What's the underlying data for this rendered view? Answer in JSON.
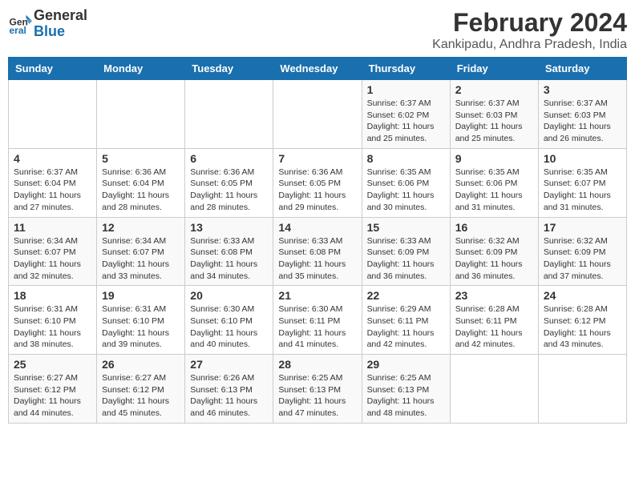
{
  "header": {
    "logo_general": "General",
    "logo_blue": "Blue",
    "title": "February 2024",
    "location": "Kankipadu, Andhra Pradesh, India"
  },
  "days_of_week": [
    "Sunday",
    "Monday",
    "Tuesday",
    "Wednesday",
    "Thursday",
    "Friday",
    "Saturday"
  ],
  "weeks": [
    [
      {
        "day": "",
        "info": ""
      },
      {
        "day": "",
        "info": ""
      },
      {
        "day": "",
        "info": ""
      },
      {
        "day": "",
        "info": ""
      },
      {
        "day": "1",
        "info": "Sunrise: 6:37 AM\nSunset: 6:02 PM\nDaylight: 11 hours\nand 25 minutes."
      },
      {
        "day": "2",
        "info": "Sunrise: 6:37 AM\nSunset: 6:03 PM\nDaylight: 11 hours\nand 25 minutes."
      },
      {
        "day": "3",
        "info": "Sunrise: 6:37 AM\nSunset: 6:03 PM\nDaylight: 11 hours\nand 26 minutes."
      }
    ],
    [
      {
        "day": "4",
        "info": "Sunrise: 6:37 AM\nSunset: 6:04 PM\nDaylight: 11 hours\nand 27 minutes."
      },
      {
        "day": "5",
        "info": "Sunrise: 6:36 AM\nSunset: 6:04 PM\nDaylight: 11 hours\nand 28 minutes."
      },
      {
        "day": "6",
        "info": "Sunrise: 6:36 AM\nSunset: 6:05 PM\nDaylight: 11 hours\nand 28 minutes."
      },
      {
        "day": "7",
        "info": "Sunrise: 6:36 AM\nSunset: 6:05 PM\nDaylight: 11 hours\nand 29 minutes."
      },
      {
        "day": "8",
        "info": "Sunrise: 6:35 AM\nSunset: 6:06 PM\nDaylight: 11 hours\nand 30 minutes."
      },
      {
        "day": "9",
        "info": "Sunrise: 6:35 AM\nSunset: 6:06 PM\nDaylight: 11 hours\nand 31 minutes."
      },
      {
        "day": "10",
        "info": "Sunrise: 6:35 AM\nSunset: 6:07 PM\nDaylight: 11 hours\nand 31 minutes."
      }
    ],
    [
      {
        "day": "11",
        "info": "Sunrise: 6:34 AM\nSunset: 6:07 PM\nDaylight: 11 hours\nand 32 minutes."
      },
      {
        "day": "12",
        "info": "Sunrise: 6:34 AM\nSunset: 6:07 PM\nDaylight: 11 hours\nand 33 minutes."
      },
      {
        "day": "13",
        "info": "Sunrise: 6:33 AM\nSunset: 6:08 PM\nDaylight: 11 hours\nand 34 minutes."
      },
      {
        "day": "14",
        "info": "Sunrise: 6:33 AM\nSunset: 6:08 PM\nDaylight: 11 hours\nand 35 minutes."
      },
      {
        "day": "15",
        "info": "Sunrise: 6:33 AM\nSunset: 6:09 PM\nDaylight: 11 hours\nand 36 minutes."
      },
      {
        "day": "16",
        "info": "Sunrise: 6:32 AM\nSunset: 6:09 PM\nDaylight: 11 hours\nand 36 minutes."
      },
      {
        "day": "17",
        "info": "Sunrise: 6:32 AM\nSunset: 6:09 PM\nDaylight: 11 hours\nand 37 minutes."
      }
    ],
    [
      {
        "day": "18",
        "info": "Sunrise: 6:31 AM\nSunset: 6:10 PM\nDaylight: 11 hours\nand 38 minutes."
      },
      {
        "day": "19",
        "info": "Sunrise: 6:31 AM\nSunset: 6:10 PM\nDaylight: 11 hours\nand 39 minutes."
      },
      {
        "day": "20",
        "info": "Sunrise: 6:30 AM\nSunset: 6:10 PM\nDaylight: 11 hours\nand 40 minutes."
      },
      {
        "day": "21",
        "info": "Sunrise: 6:30 AM\nSunset: 6:11 PM\nDaylight: 11 hours\nand 41 minutes."
      },
      {
        "day": "22",
        "info": "Sunrise: 6:29 AM\nSunset: 6:11 PM\nDaylight: 11 hours\nand 42 minutes."
      },
      {
        "day": "23",
        "info": "Sunrise: 6:28 AM\nSunset: 6:11 PM\nDaylight: 11 hours\nand 42 minutes."
      },
      {
        "day": "24",
        "info": "Sunrise: 6:28 AM\nSunset: 6:12 PM\nDaylight: 11 hours\nand 43 minutes."
      }
    ],
    [
      {
        "day": "25",
        "info": "Sunrise: 6:27 AM\nSunset: 6:12 PM\nDaylight: 11 hours\nand 44 minutes."
      },
      {
        "day": "26",
        "info": "Sunrise: 6:27 AM\nSunset: 6:12 PM\nDaylight: 11 hours\nand 45 minutes."
      },
      {
        "day": "27",
        "info": "Sunrise: 6:26 AM\nSunset: 6:13 PM\nDaylight: 11 hours\nand 46 minutes."
      },
      {
        "day": "28",
        "info": "Sunrise: 6:25 AM\nSunset: 6:13 PM\nDaylight: 11 hours\nand 47 minutes."
      },
      {
        "day": "29",
        "info": "Sunrise: 6:25 AM\nSunset: 6:13 PM\nDaylight: 11 hours\nand 48 minutes."
      },
      {
        "day": "",
        "info": ""
      },
      {
        "day": "",
        "info": ""
      }
    ]
  ]
}
